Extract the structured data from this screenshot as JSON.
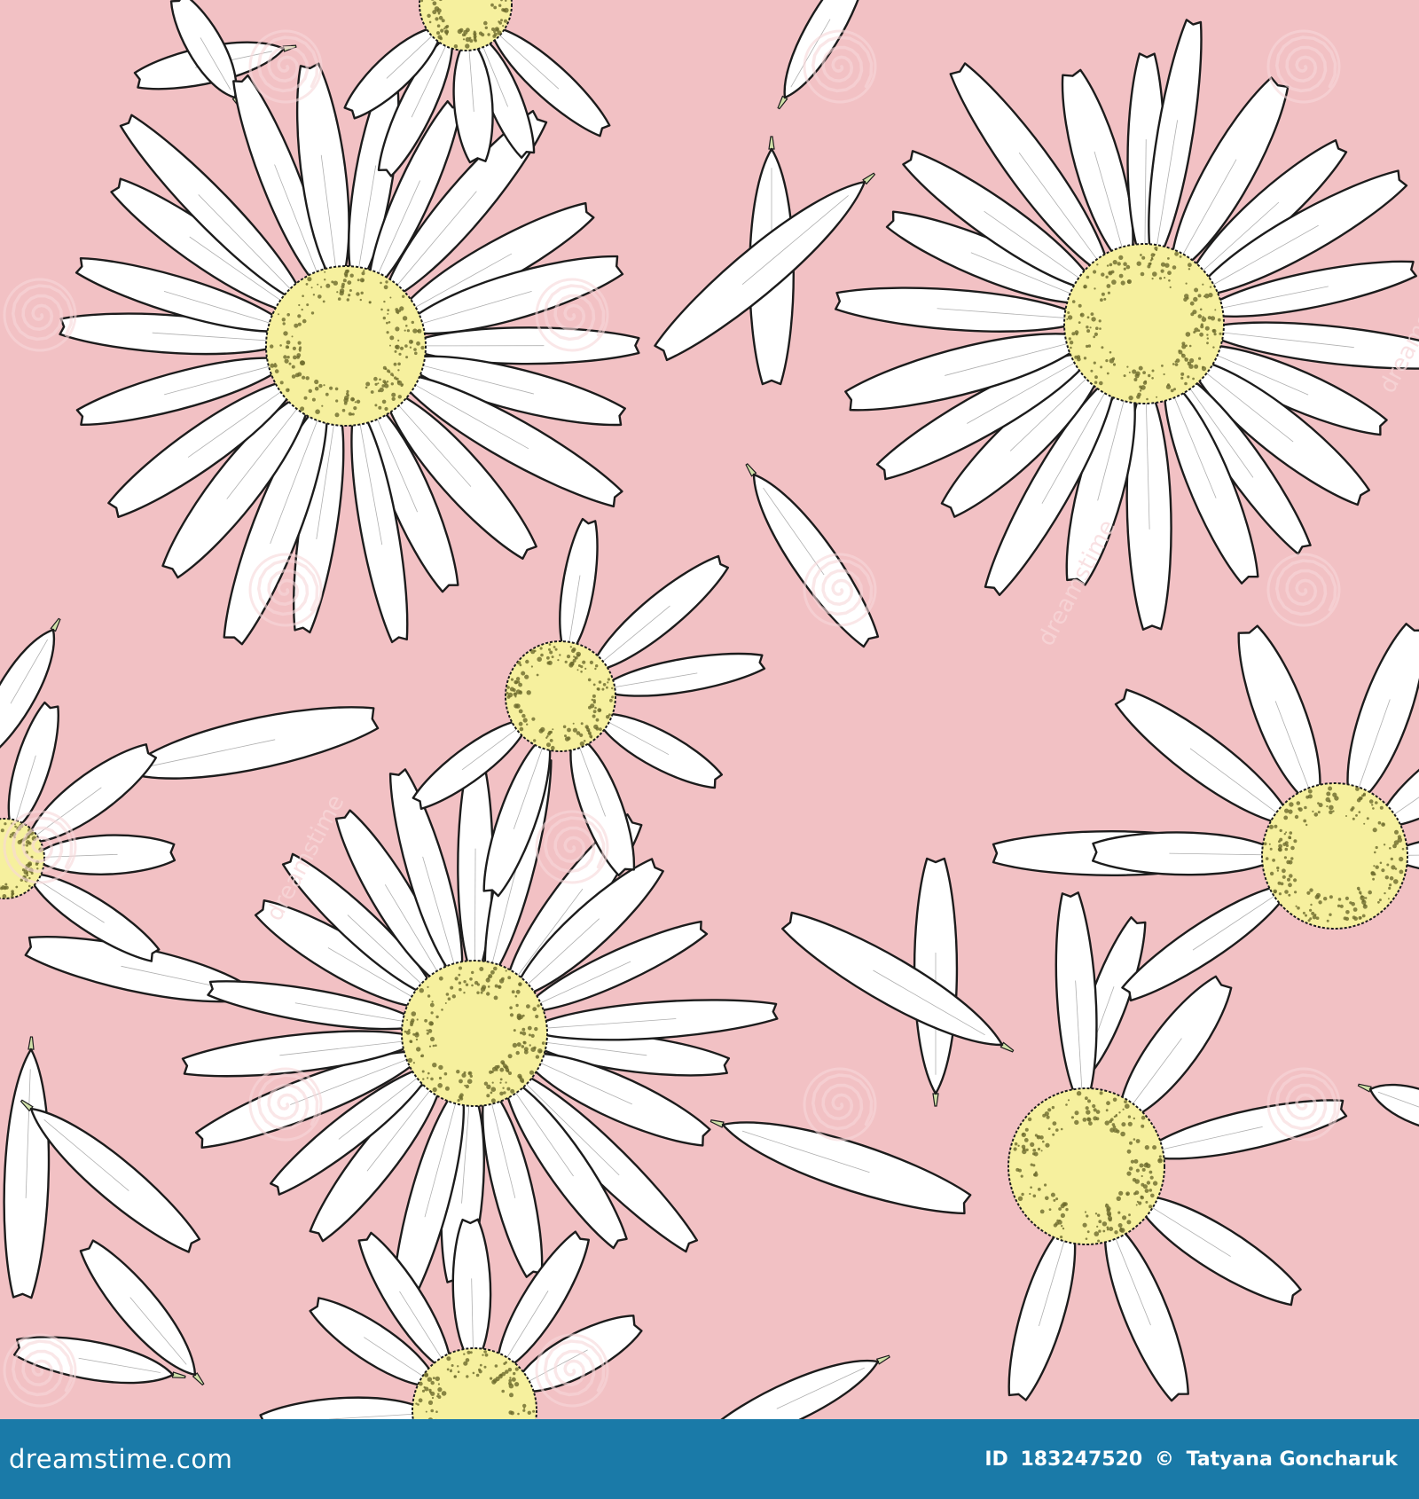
{
  "colors": {
    "background": "#f2c1c4",
    "petal_fill": "#ffffff",
    "outline": "#1c1c1c",
    "flower_center": "#f6f09e",
    "flower_center_speckle": "#6d6a2c",
    "petal_tip": "#cfe0a8",
    "watermark": "#f8d8da",
    "footer_bar": "#1a7aa8",
    "footer_text": "#ffffff"
  },
  "watermark": {
    "icon": "spiral-swirl-icon",
    "text": "dreamstime"
  },
  "footer": {
    "site": "dreamstime.com",
    "id_label": "ID",
    "id_value": "183247520",
    "copyright_symbol": "©",
    "author": "Tatyana Goncharuk"
  }
}
